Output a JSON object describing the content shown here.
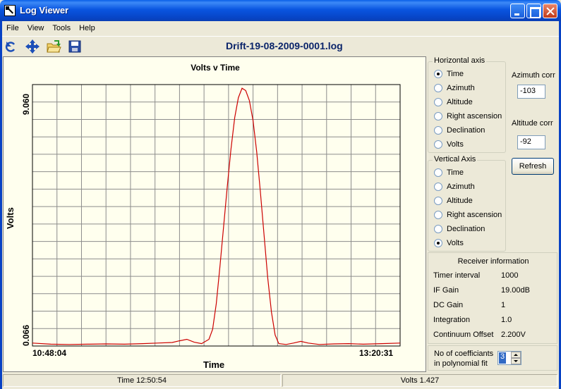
{
  "window": {
    "title": "Log Viewer"
  },
  "menu": {
    "items": [
      "File",
      "View",
      "Tools",
      "Help"
    ]
  },
  "toolbar": {
    "buttons": [
      "refresh-icon",
      "pan-icon",
      "open-folder-icon",
      "save-icon"
    ],
    "file_title": "Drift-19-08-2009-0001.log"
  },
  "chart_data": {
    "type": "line",
    "title": "Volts v Time",
    "xlabel": "Time",
    "ylabel": "Volts",
    "x_tick_labels": [
      "10:48:04",
      "13:20:31"
    ],
    "y_tick_labels": [
      "0.066",
      "9.060"
    ],
    "ylim": [
      0.066,
      9.06
    ],
    "grid": true,
    "series": [
      {
        "color": "#cc0000",
        "points": [
          [
            0.0,
            0.12
          ],
          [
            0.05,
            0.08
          ],
          [
            0.1,
            0.07
          ],
          [
            0.15,
            0.08
          ],
          [
            0.2,
            0.09
          ],
          [
            0.25,
            0.08
          ],
          [
            0.3,
            0.1
          ],
          [
            0.34,
            0.12
          ],
          [
            0.38,
            0.14
          ],
          [
            0.4,
            0.2
          ],
          [
            0.42,
            0.25
          ],
          [
            0.44,
            0.15
          ],
          [
            0.46,
            0.1
          ],
          [
            0.48,
            0.25
          ],
          [
            0.49,
            0.6
          ],
          [
            0.5,
            1.5
          ],
          [
            0.51,
            2.8
          ],
          [
            0.52,
            4.2
          ],
          [
            0.53,
            5.6
          ],
          [
            0.54,
            6.9
          ],
          [
            0.55,
            8.0
          ],
          [
            0.56,
            8.7
          ],
          [
            0.57,
            9.03
          ],
          [
            0.58,
            8.95
          ],
          [
            0.59,
            8.6
          ],
          [
            0.6,
            7.9
          ],
          [
            0.61,
            6.8
          ],
          [
            0.62,
            5.4
          ],
          [
            0.63,
            3.9
          ],
          [
            0.64,
            2.4
          ],
          [
            0.65,
            1.2
          ],
          [
            0.66,
            0.4
          ],
          [
            0.67,
            0.1
          ],
          [
            0.69,
            0.07
          ],
          [
            0.71,
            0.12
          ],
          [
            0.73,
            0.18
          ],
          [
            0.75,
            0.12
          ],
          [
            0.78,
            0.07
          ],
          [
            0.82,
            0.09
          ],
          [
            0.86,
            0.1
          ],
          [
            0.9,
            0.08
          ],
          [
            0.95,
            0.1
          ],
          [
            1.0,
            0.12
          ]
        ]
      }
    ]
  },
  "horizontal_axis": {
    "legend": "Horizontal axis",
    "options": [
      "Time",
      "Azimuth",
      "Altitude",
      "Right ascension",
      "Declination",
      "Volts"
    ],
    "selected": "Time"
  },
  "vertical_axis": {
    "legend": "Vertical Axis",
    "options": [
      "Time",
      "Azimuth",
      "Altitude",
      "Right ascension",
      "Declination",
      "Volts"
    ],
    "selected": "Volts"
  },
  "corrections": {
    "azimuth_label": "Azimuth corr",
    "azimuth_value": "-103",
    "altitude_label": "Altitude corr",
    "altitude_value": "-92",
    "refresh_label": "Refresh"
  },
  "receiver": {
    "title": "Receiver information",
    "rows": [
      {
        "label": "Timer interval",
        "value": "1000"
      },
      {
        "label": "IF Gain",
        "value": "19.00dB"
      },
      {
        "label": "DC Gain",
        "value": "1"
      },
      {
        "label": "Integration",
        "value": "1.0"
      },
      {
        "label": "Continuum Offset",
        "value": "2.200V"
      }
    ]
  },
  "coefficients": {
    "label_line1": "No of coefficiants",
    "label_line2": "in polynomial fit",
    "value": "3"
  },
  "status": {
    "time": "Time 12:50:54",
    "volts": "Volts 1.427"
  }
}
